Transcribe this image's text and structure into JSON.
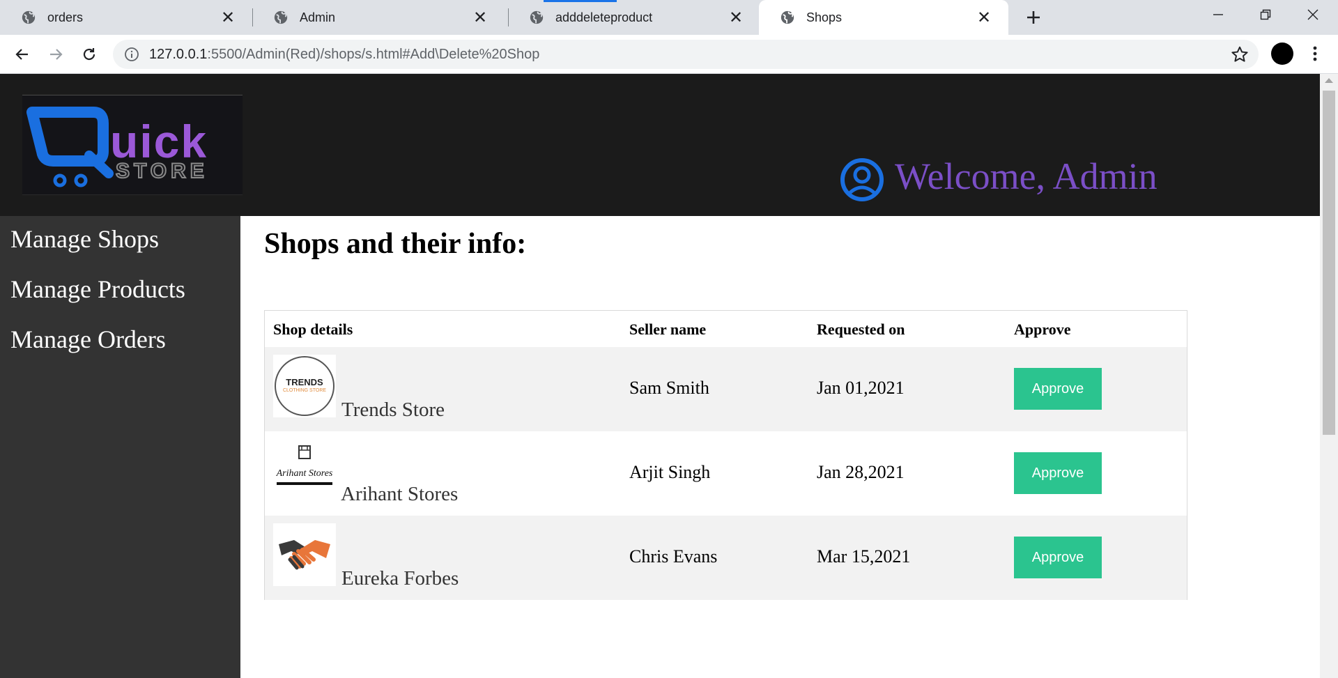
{
  "browser": {
    "tabs": [
      {
        "title": "orders"
      },
      {
        "title": "Admin"
      },
      {
        "title": "adddeleteproduct"
      },
      {
        "title": "Shops"
      }
    ],
    "url": {
      "host": "127.0.0.1",
      "rest": ":5500/Admin(Red)/shops/s.html#Add\\Delete%20Shop"
    }
  },
  "header": {
    "logo_text": "uick",
    "logo_subtext": "STORE",
    "welcome": "Welcome, Admin"
  },
  "sidebar": {
    "items": [
      {
        "label": "Manage Shops"
      },
      {
        "label": "Manage Products"
      },
      {
        "label": "Manage Orders"
      }
    ]
  },
  "main": {
    "title": "Shops and their info:",
    "table": {
      "headers": [
        "Shop details",
        "Seller name",
        "Requested on",
        "Approve"
      ],
      "rows": [
        {
          "shop": "Trends Store",
          "logo_text": "TRENDS",
          "logo_subtext": "CLOTHING STORE",
          "seller": "Sam Smith",
          "date": "Jan 01,2021",
          "action": "Approve"
        },
        {
          "shop": "Arihant Stores",
          "logo_text": "Arihant Stores",
          "seller": "Arjit Singh",
          "date": "Jan 28,2021",
          "action": "Approve"
        },
        {
          "shop": "Eureka Forbes",
          "seller": "Chris Evans",
          "date": "Mar 15,2021",
          "action": "Approve"
        }
      ]
    }
  },
  "colors": {
    "header_bg": "#1b1b1b",
    "sidebar_bg": "#333333",
    "accent_purple": "#7b4fc7",
    "icon_blue": "#1a6fe0",
    "approve_green": "#2bc48f"
  }
}
